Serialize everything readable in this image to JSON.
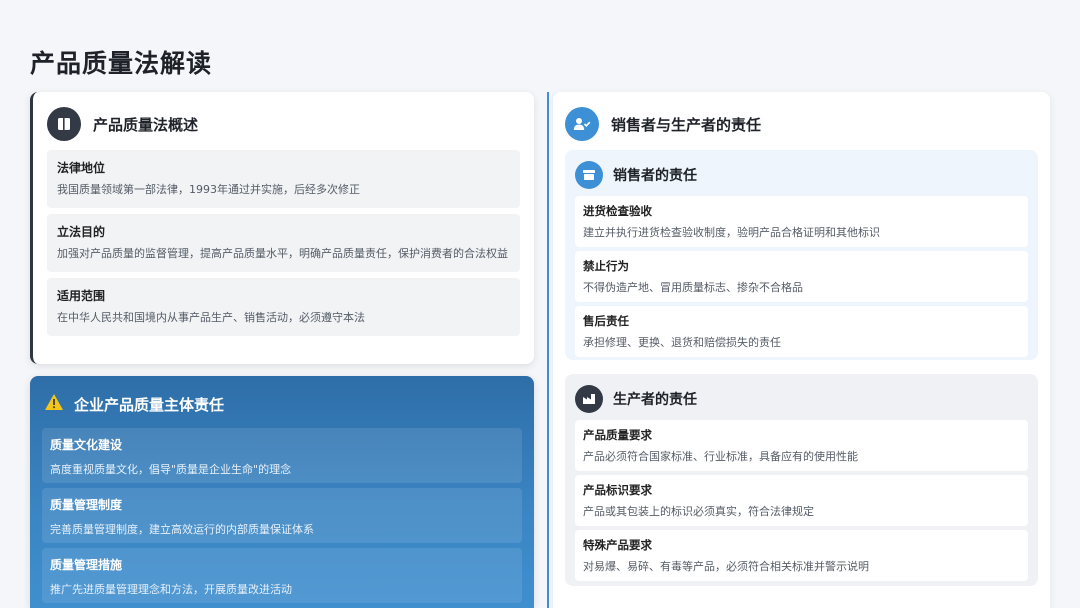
{
  "page": {
    "title": "产品质量法解读"
  },
  "overview": {
    "title": "产品质量法概述",
    "icon": "book-icon",
    "items": [
      {
        "label": "法律地位",
        "text": "我国质量领域第一部法律，1993年通过并实施，后经多次修正"
      },
      {
        "label": "立法目的",
        "text": "加强对产品质量的监督管理，提高产品质量水平，明确产品质量责任，保护消费者的合法权益"
      },
      {
        "label": "适用范围",
        "text": "在中华人民共和国境内从事产品生产、销售活动，必须遵守本法"
      }
    ]
  },
  "enterprise": {
    "title": "企业产品质量主体责任",
    "icon": "warning-icon",
    "items": [
      {
        "label": "质量文化建设",
        "text": "高度重视质量文化，倡导\"质量是企业生命\"的理念"
      },
      {
        "label": "质量管理制度",
        "text": "完善质量管理制度，建立高效运行的内部质量保证体系"
      },
      {
        "label": "质量管理措施",
        "text": "推广先进质量管理理念和方法，开展质量改进活动"
      }
    ]
  },
  "responsibility": {
    "title": "销售者与生产者的责任",
    "icon": "user-check-icon",
    "seller": {
      "title": "销售者的责任",
      "icon": "store-icon",
      "items": [
        {
          "label": "进货检查验收",
          "text": "建立并执行进货检查验收制度，验明产品合格证明和其他标识"
        },
        {
          "label": "禁止行为",
          "text": "不得伪造产地、冒用质量标志、掺杂不合格品"
        },
        {
          "label": "售后责任",
          "text": "承担修理、更换、退货和赔偿损失的责任"
        }
      ]
    },
    "producer": {
      "title": "生产者的责任",
      "icon": "factory-icon",
      "items": [
        {
          "label": "产品质量要求",
          "text": "产品必须符合国家标准、行业标准，具备应有的使用性能"
        },
        {
          "label": "产品标识要求",
          "text": "产品或其包装上的标识必须真实，符合法律规定"
        },
        {
          "label": "特殊产品要求",
          "text": "对易爆、易碎、有毒等产品，必须符合相关标准并警示说明"
        }
      ]
    }
  },
  "colors": {
    "accent": "#3d8fd6",
    "dark": "#333a45",
    "enterprise_bg": "#2e6ea8"
  }
}
